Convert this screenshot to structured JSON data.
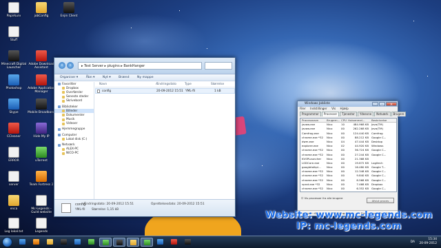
{
  "desktop": {
    "icons": [
      {
        "label": "Papirkurv",
        "icon": "recycle-bin-icon"
      },
      {
        "label": "jobConfig",
        "icon": "folder-icon"
      },
      {
        "label": "Enjin Client",
        "icon": "enjin-client-icon"
      },
      {
        "label": "Stuff",
        "icon": "document-icon"
      },
      {
        "label": "Minecraft Digital Launcher",
        "icon": "minecraft-icon"
      },
      {
        "label": "Adobe Download Assistant",
        "icon": "adobe-icon"
      },
      {
        "label": "Photoshop",
        "icon": "photoshop-icon"
      },
      {
        "label": "Adobe Application Manager",
        "icon": "adobe-icon"
      },
      {
        "label": "Skype",
        "icon": "skype-icon"
      },
      {
        "label": "Mobile Broadband",
        "icon": "broadband-icon"
      },
      {
        "label": "CCleaner",
        "icon": "ccleaner-icon"
      },
      {
        "label": "Hide My IP",
        "icon": "hide-ip-icon"
      },
      {
        "label": "ERROR",
        "icon": "document-icon"
      },
      {
        "label": "uTorrent",
        "icon": "utorrent-icon"
      },
      {
        "label": "server",
        "icon": "document-icon"
      },
      {
        "label": "Team Fortress 2",
        "icon": "team-fortress-icon"
      },
      {
        "label": "enca",
        "icon": "folder-icon"
      },
      {
        "label": "Mc-Legends - Guild website",
        "icon": "document-icon"
      },
      {
        "label": "Log lokal.txt",
        "icon": "document-icon"
      },
      {
        "label": "Legends",
        "icon": "document-icon"
      }
    ]
  },
  "explorer": {
    "breadcrumb": "▸ Test Server ▸ plugins ▸ BankHanger",
    "toolbar": [
      "Organiser ▾",
      "Åbn ▾",
      "Nyt ▾",
      "Brænd",
      "Ny mappe"
    ],
    "nav": [
      {
        "label": "Favoritter",
        "indent": false
      },
      {
        "label": "Dropbox",
        "indent": true
      },
      {
        "label": "Overførsler",
        "indent": true
      },
      {
        "label": "Seneste steder",
        "indent": true
      },
      {
        "label": "Skrivebord",
        "indent": true
      },
      {
        "label": "Biblioteker",
        "indent": false,
        "gap": true
      },
      {
        "label": "Billeder",
        "indent": true,
        "selected": true
      },
      {
        "label": "Dokumenter",
        "indent": true
      },
      {
        "label": "Musik",
        "indent": true
      },
      {
        "label": "Videoer",
        "indent": true
      },
      {
        "label": "Hjemmegruppe",
        "indent": false,
        "gap": true
      },
      {
        "label": "Computer",
        "indent": false,
        "gap": true
      },
      {
        "label": "Lokal disk (C:)",
        "indent": true
      },
      {
        "label": "Netværk",
        "indent": false,
        "gap": true
      },
      {
        "label": "ALEX-PC",
        "indent": true
      },
      {
        "label": "NICO-PC",
        "indent": true
      }
    ],
    "columns": [
      "Navn",
      "Ændringsdato",
      "Type",
      "Størrelse"
    ],
    "files": [
      {
        "name": "config",
        "date": "20-09-2012 15:51",
        "type": "YML-fil",
        "size": "1 kB"
      }
    ],
    "status": {
      "name": "config",
      "modified_label": "Ændringsdato: 20-09-2012 15:51",
      "created_label": "Oprettelsesdato: 20-09-2012 15:51",
      "type": "YML-fil",
      "size_label": "Størrelse: 1,15 kB"
    }
  },
  "taskmgr": {
    "title": "Windows Jobliste",
    "menu": [
      "Filer",
      "Indstillinger",
      "Vis",
      "Hjælp"
    ],
    "tabs": [
      "Programmer",
      "Processer",
      "Tjenester",
      "Ydeevne",
      "Netværk",
      "Brugere"
    ],
    "active_tab": 1,
    "columns": [
      "Processnavn",
      "Brugern...",
      "CPU",
      "Hukommel...",
      "Beskrivelse"
    ],
    "rows": [
      {
        "name": "javaw.exe",
        "user": "Nico",
        "cpu": "10",
        "mem": "484.968 KB",
        "desc": "Java(TM)"
      },
      {
        "name": "javaw.exe",
        "user": "Nico",
        "cpu": "00",
        "mem": "262.268 KB",
        "desc": "Java(TM)"
      },
      {
        "name": "Camfrog.exe",
        "user": "Nico",
        "cpu": "00",
        "mem": "124.440 KB",
        "desc": "Camfrog"
      },
      {
        "name": "chrome.exe *32",
        "user": "Nico",
        "cpu": "00",
        "mem": "88.212 KB",
        "desc": "Google C..."
      },
      {
        "name": "dwm.exe",
        "user": "Nico",
        "cpu": "04",
        "mem": "47.444 KB",
        "desc": "Desktop"
      },
      {
        "name": "explorer.exe",
        "user": "Nico",
        "cpu": "02",
        "mem": "44.920 KB",
        "desc": "Windows"
      },
      {
        "name": "chrome.exe *32",
        "user": "Nico",
        "cpu": "00",
        "mem": "36.724 KB",
        "desc": "Google C..."
      },
      {
        "name": "chrome.exe *32",
        "user": "Nico",
        "cpu": "00",
        "mem": "27.244 KB",
        "desc": "Google C..."
      },
      {
        "name": "KVSPLauncher",
        "user": "Nico",
        "cpu": "00",
        "mem": "21.368 KB",
        "desc": ""
      },
      {
        "name": "LGDCore.exe",
        "user": "Nico",
        "cpu": "00",
        "mem": "19.872 KB",
        "desc": "Logitech"
      },
      {
        "name": "googletalkpl...",
        "user": "Nico",
        "cpu": "00",
        "mem": "16.480 KB",
        "desc": "Google T..."
      },
      {
        "name": "chrome.exe *32",
        "user": "Nico",
        "cpu": "00",
        "mem": "12.348 KB",
        "desc": "Google C..."
      },
      {
        "name": "chrome.exe *32",
        "user": "Nico",
        "cpu": "00",
        "mem": "9.840 KB",
        "desc": "Google C..."
      },
      {
        "name": "chrome.exe *32",
        "user": "Nico",
        "cpu": "00",
        "mem": "8.568 KB",
        "desc": "Google C..."
      },
      {
        "name": "vprot.exe *32",
        "user": "Nico",
        "cpu": "00",
        "mem": "7.468 KB",
        "desc": "Dropbox"
      },
      {
        "name": "chrome.exe *32",
        "user": "Nico",
        "cpu": "00",
        "mem": "6.352 KB",
        "desc": "Google C..."
      },
      {
        "name": "hkcmd.exe",
        "user": "Nico",
        "cpu": "00",
        "mem": "3.396 KB",
        "desc": "hkcmd Mo..."
      },
      {
        "name": "nvtray.exe",
        "user": "Nico",
        "cpu": "00",
        "mem": "3.100 KB",
        "desc": "NVIDIA S..."
      },
      {
        "name": "rundll32.exe",
        "user": "Nico",
        "cpu": "00",
        "mem": "2.732 KB",
        "desc": "Windows"
      },
      {
        "name": "taskeng.exe",
        "user": "Nico",
        "cpu": "00",
        "mem": "2.316 KB",
        "desc": "Procesm..."
      }
    ],
    "show_all_label": "Vis processer fra alle brugere",
    "end_process": "Afslut proces",
    "status": {
      "processes": "Processer: 62",
      "cpu": "CPU-brug: 44%",
      "memory": "Fys. hukommelse: 59%"
    }
  },
  "overlay": {
    "website": "Website: www.mc-legends.com",
    "ip": "IP: mc-legends.com"
  },
  "taskbar": {
    "lang": "DA",
    "time": "15:34",
    "date": "20-09-2012"
  },
  "colors": {
    "overlay_text": "#1f6fe8",
    "taskbar": "#16263c",
    "selection": "#3a8ee6"
  }
}
